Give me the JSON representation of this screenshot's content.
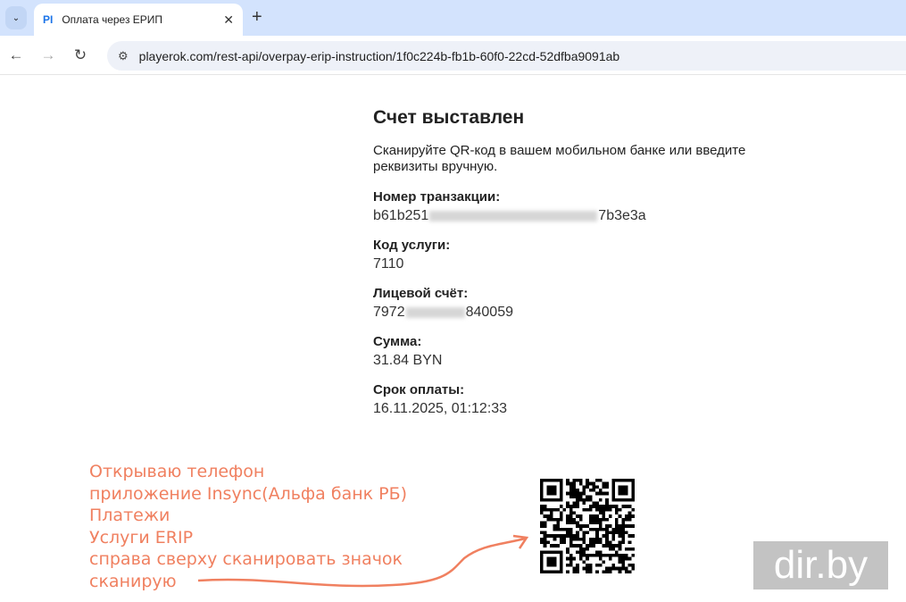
{
  "browser": {
    "tab_title": "Оплата через ЕРИП",
    "favicon": "PI",
    "url": "playerok.com/rest-api/overpay-erip-instruction/1f0c224b-fb1b-60f0-22cd-52dfba9091ab"
  },
  "page": {
    "title": "Счет выставлен",
    "description": "Сканируйте QR-код в вашем мобильном банке или введите реквизиты вручную.",
    "fields": [
      {
        "label": "Номер транзакции:",
        "value_start": "b61b251",
        "value_end": "7b3e3a"
      },
      {
        "label": "Код услуги:",
        "value": "7110"
      },
      {
        "label": "Лицевой счёт:",
        "value_start": "7972",
        "value_end": "840059"
      },
      {
        "label": "Сумма:",
        "value": "31.84 BYN"
      },
      {
        "label": "Срок оплаты:",
        "value": "16.11.2025, 01:12:33"
      }
    ]
  },
  "annotation": {
    "lines": [
      "Открываю телефон",
      "приложение Insync(Альфа банк РБ)",
      "Платежи",
      "Услуги ERIP",
      "справа сверху сканировать значок",
      "сканирую"
    ],
    "color": "#f08060"
  },
  "watermark": "dir.by"
}
